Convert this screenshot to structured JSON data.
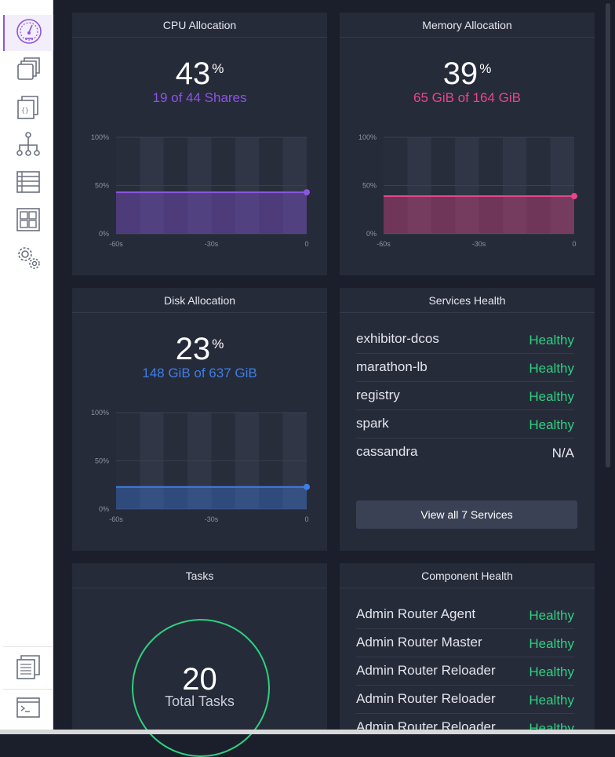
{
  "sidebar": {
    "items": [
      {
        "icon": "dashboard-gauge-icon",
        "active": true
      },
      {
        "icon": "services-stack-icon",
        "active": false
      },
      {
        "icon": "jobs-document-icon",
        "active": false
      },
      {
        "icon": "network-hierarchy-icon",
        "active": false
      },
      {
        "icon": "nodes-list-icon",
        "active": false
      },
      {
        "icon": "catalog-grid-icon",
        "active": false
      },
      {
        "icon": "settings-gears-icon",
        "active": false
      }
    ],
    "bottom_items": [
      {
        "icon": "documentation-icon"
      },
      {
        "icon": "cli-terminal-icon"
      }
    ]
  },
  "cpu": {
    "title": "CPU Allocation",
    "percent": "43",
    "percent_sign": "%",
    "detail": "19 of 44 Shares",
    "color": "#8b55e0",
    "chart": {
      "x_ticks": [
        "-60s",
        "-30s",
        "0"
      ],
      "y_ticks": [
        "100%",
        "50%",
        "0%"
      ],
      "value": 43
    }
  },
  "memory": {
    "title": "Memory Allocation",
    "percent": "39",
    "percent_sign": "%",
    "detail": "65 GiB of 164 GiB",
    "color": "#e8468b",
    "chart": {
      "x_ticks": [
        "-60s",
        "-30s",
        "0"
      ],
      "y_ticks": [
        "100%",
        "50%",
        "0%"
      ],
      "value": 39
    }
  },
  "disk": {
    "title": "Disk Allocation",
    "percent": "23",
    "percent_sign": "%",
    "detail": "148 GiB of 637 GiB",
    "color": "#3d7fe6",
    "chart": {
      "x_ticks": [
        "-60s",
        "-30s",
        "0"
      ],
      "y_ticks": [
        "100%",
        "50%",
        "0%"
      ],
      "value": 23
    }
  },
  "services": {
    "title": "Services Health",
    "rows": [
      {
        "name": "exhibitor-dcos",
        "status": "Healthy"
      },
      {
        "name": "marathon-lb",
        "status": "Healthy"
      },
      {
        "name": "registry",
        "status": "Healthy"
      },
      {
        "name": "spark",
        "status": "Healthy"
      },
      {
        "name": "cassandra",
        "status": "N/A"
      }
    ],
    "button": "View all 7 Services"
  },
  "tasks": {
    "title": "Tasks",
    "count": "20",
    "label": "Total Tasks"
  },
  "components": {
    "title": "Component Health",
    "rows": [
      {
        "name": "Admin Router Agent",
        "status": "Healthy"
      },
      {
        "name": "Admin Router Master",
        "status": "Healthy"
      },
      {
        "name": "Admin Router Reloader",
        "status": "Healthy"
      },
      {
        "name": "Admin Router Reloader",
        "status": "Healthy"
      },
      {
        "name": "Admin Router Reloader",
        "status": "Healthy"
      }
    ]
  },
  "colors": {
    "healthy": "#2fd07f",
    "na": "#e4e5ec"
  }
}
